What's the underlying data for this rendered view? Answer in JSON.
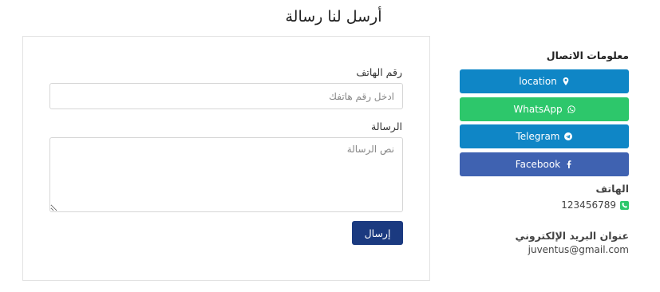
{
  "page": {
    "title": "أرسل لنا رسالة"
  },
  "form": {
    "phone_label": "رقم الهاتف",
    "phone_placeholder": "ادخل رقم هاتفك",
    "message_label": "الرسالة",
    "message_placeholder": "نص الرسالة",
    "submit_label": "إرسال"
  },
  "contact": {
    "heading": "معلومات الاتصال",
    "buttons": [
      {
        "label": "location",
        "icon": "map-pin-icon",
        "color": "#0f86c6"
      },
      {
        "label": "WhatsApp",
        "icon": "whatsapp-icon",
        "color": "#2dc76b"
      },
      {
        "label": "Telegram",
        "icon": "telegram-icon",
        "color": "#0f86c6"
      },
      {
        "label": "Facebook",
        "icon": "facebook-icon",
        "color": "#3f62b1"
      }
    ],
    "phone_label": "الهاتف",
    "phone_value": "123456789",
    "email_label": "عنوان البريد الإلكتروني",
    "email_value": "juventus@gmail.com"
  },
  "colors": {
    "submit_button": "#1b3a80",
    "border": "#e2e2e2"
  }
}
